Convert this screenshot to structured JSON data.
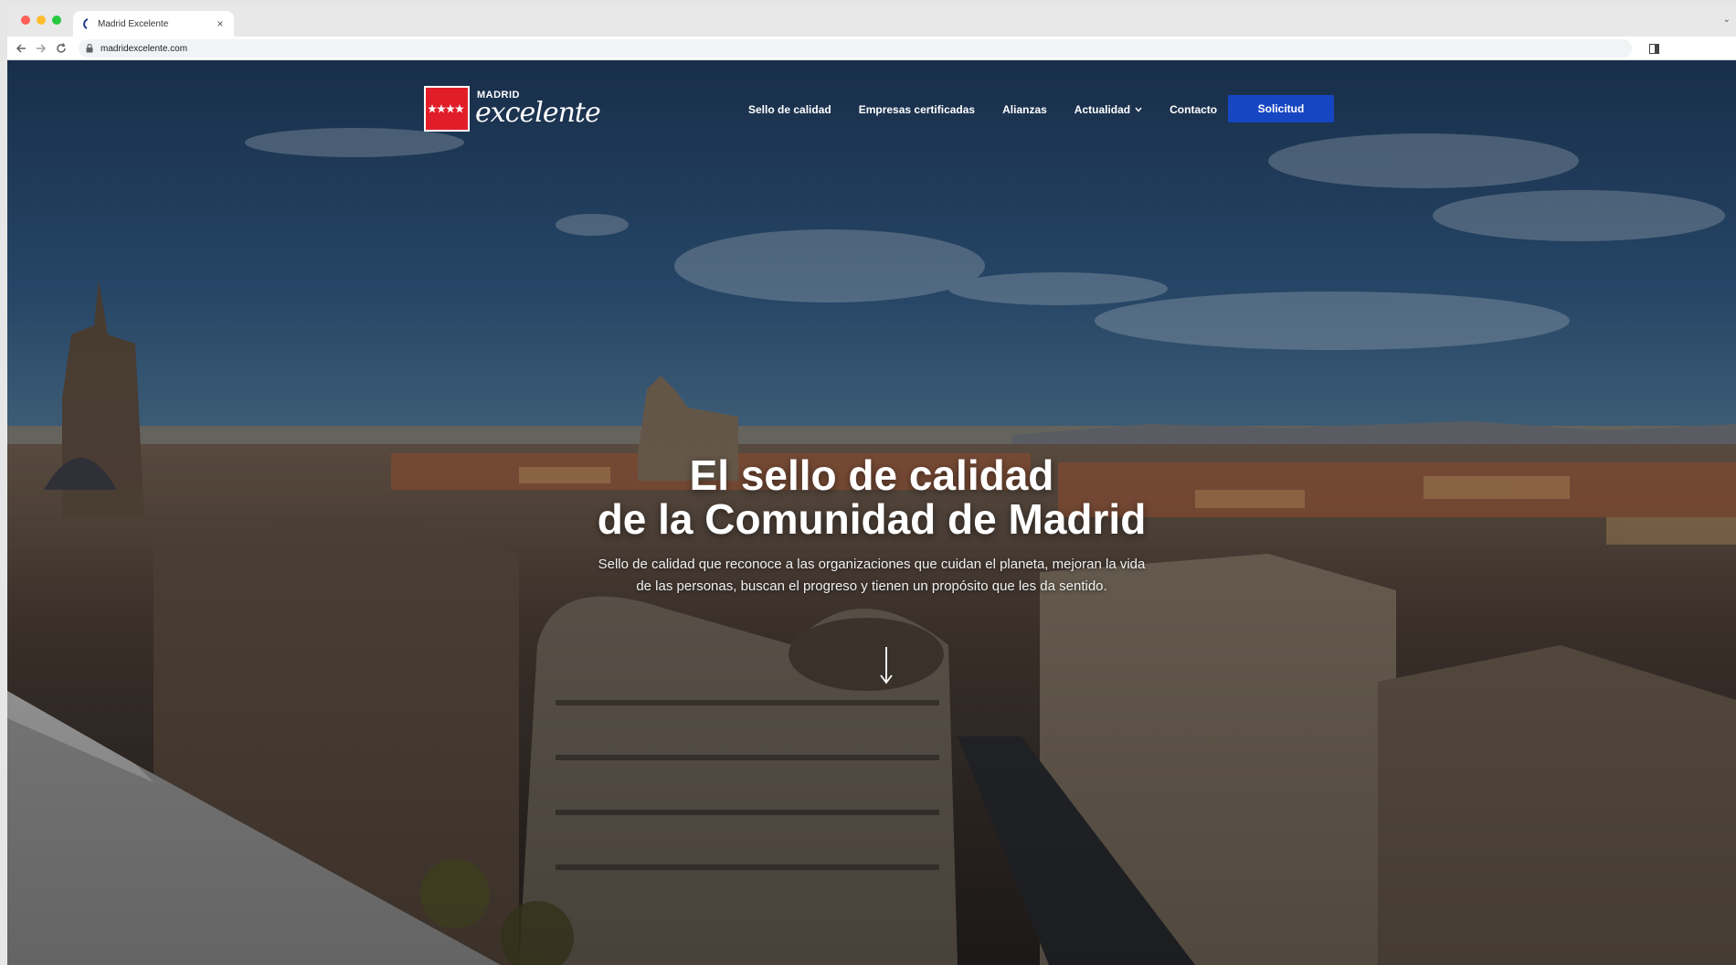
{
  "browser": {
    "tab_title": "Madrid Excelente",
    "tab_close": "×",
    "url": "madridexcelente.com",
    "tabstrip_menu": "⌄"
  },
  "site": {
    "logo_small": "MADRID",
    "logo_script": "excelente",
    "nav": [
      {
        "label": "Sello de calidad"
      },
      {
        "label": "Empresas certificadas"
      },
      {
        "label": "Alianzas"
      },
      {
        "label": "Actualidad",
        "has_dropdown": true
      },
      {
        "label": "Contacto"
      }
    ],
    "cta_label": "Solicitud",
    "cta_color": "#1646c2",
    "brand_red": "#e11d2a"
  },
  "hero": {
    "title_line1": "El sello de calidad",
    "title_line2": "de la Comunidad de Madrid",
    "subtitle": "Sello de calidad que reconoce a las organizaciones que cuidan el planeta, mejoran la vida de las personas, buscan el progreso y tienen un propósito que les da sentido."
  },
  "icons": {
    "back": "arrow-left-icon",
    "forward": "arrow-right-icon",
    "reload": "reload-icon",
    "lock": "lock-icon",
    "scroll": "arrow-down-icon"
  }
}
